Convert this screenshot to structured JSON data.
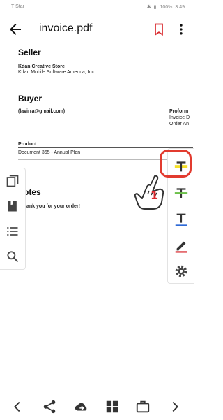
{
  "status_bar": {
    "carrier": "T Star",
    "battery": "100%",
    "time": "3:49"
  },
  "app_bar": {
    "title": "invoice.pdf",
    "icons": [
      "back-arrow-icon",
      "bookmark-icon",
      "more-vert-icon"
    ]
  },
  "document": {
    "seller_heading": "Seller",
    "seller_store": "Kdan Creative Store",
    "seller_company": "Kdan Mobile Software America, Inc.",
    "buyer_heading": "Buyer",
    "buyer_email": "(lavirra@gmail.com)",
    "proforma_label": "Proform",
    "invoice_label": "Invoice D",
    "order_label": "Order An",
    "product_header": "Product",
    "product_item": "Document 365 - Annual Plan",
    "notes_heading": "otes",
    "notes_text": "ank you for your order!"
  },
  "left_panel": {
    "icons": [
      "pages-icon",
      "bookmarks-icon",
      "outline-list-icon",
      "search-icon"
    ]
  },
  "right_panel": {
    "icons": [
      "highlight-text-icon",
      "strikethrough-text-icon",
      "underline-text-icon",
      "pen-icon",
      "settings-icon"
    ],
    "colors": {
      "highlight": "#f5e028",
      "strike": "#6cc04a",
      "underline": "#2e6ad6",
      "pen": "#d8262b"
    }
  },
  "annotation": {
    "step_number": "1",
    "ring_color": "#e23b2f"
  },
  "bottom_bar": {
    "icons": [
      "prev-icon",
      "share-icon",
      "cloud-sync-icon",
      "grid-icon",
      "briefcase-icon",
      "next-icon"
    ]
  }
}
